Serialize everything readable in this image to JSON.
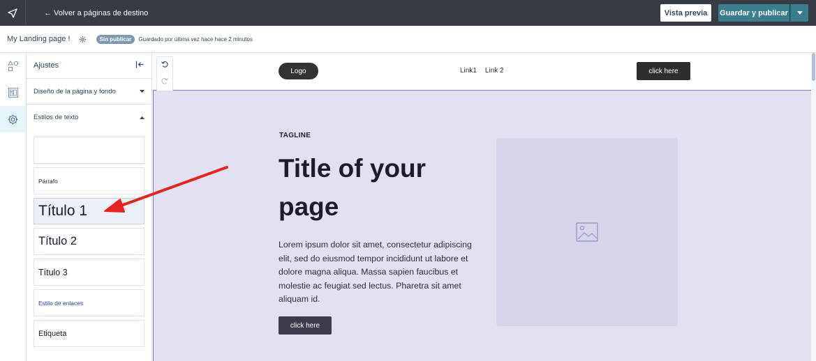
{
  "topbar": {
    "back_label": "← Volver a páginas de destino",
    "preview_label": "Vista previa",
    "publish_label": "Guardar y publicar"
  },
  "subbar": {
    "page_name": "My Landing page !",
    "status_badge": "Sin publicar",
    "saved_text": "Guardado por última vez hace hace 2 minutos"
  },
  "panel": {
    "title": "Ajustes",
    "section_design": "Diseño de la página y fondo",
    "section_text_styles": "Estilos de texto",
    "styles": {
      "paragraph": "Párrafo",
      "h1": "Título 1",
      "h2": "Título 2",
      "h3": "Título 3",
      "links": "Estilo de enlaces",
      "label": "Etiqueta"
    }
  },
  "landing": {
    "logo": "Logo",
    "link1": "Link1",
    "link2": "Link 2",
    "header_cta": "click here",
    "tagline": "TAGLINE",
    "title": "Title of your page",
    "body": "Lorem ipsum dolor sit amet, consectetur adipiscing elit, sed do eiusmod tempor incididunt ut labore et dolore magna aliqua. Massa sapien faucibus et molestie ac feugiat sed lectus. Pharetra sit amet aliquam id.",
    "hero_cta": "click here"
  },
  "colors": {
    "topbar": "#363b45",
    "publish": "#3a7d8c",
    "hero_bg": "#e1e1f2",
    "annotation_arrow": "#e8231f"
  }
}
